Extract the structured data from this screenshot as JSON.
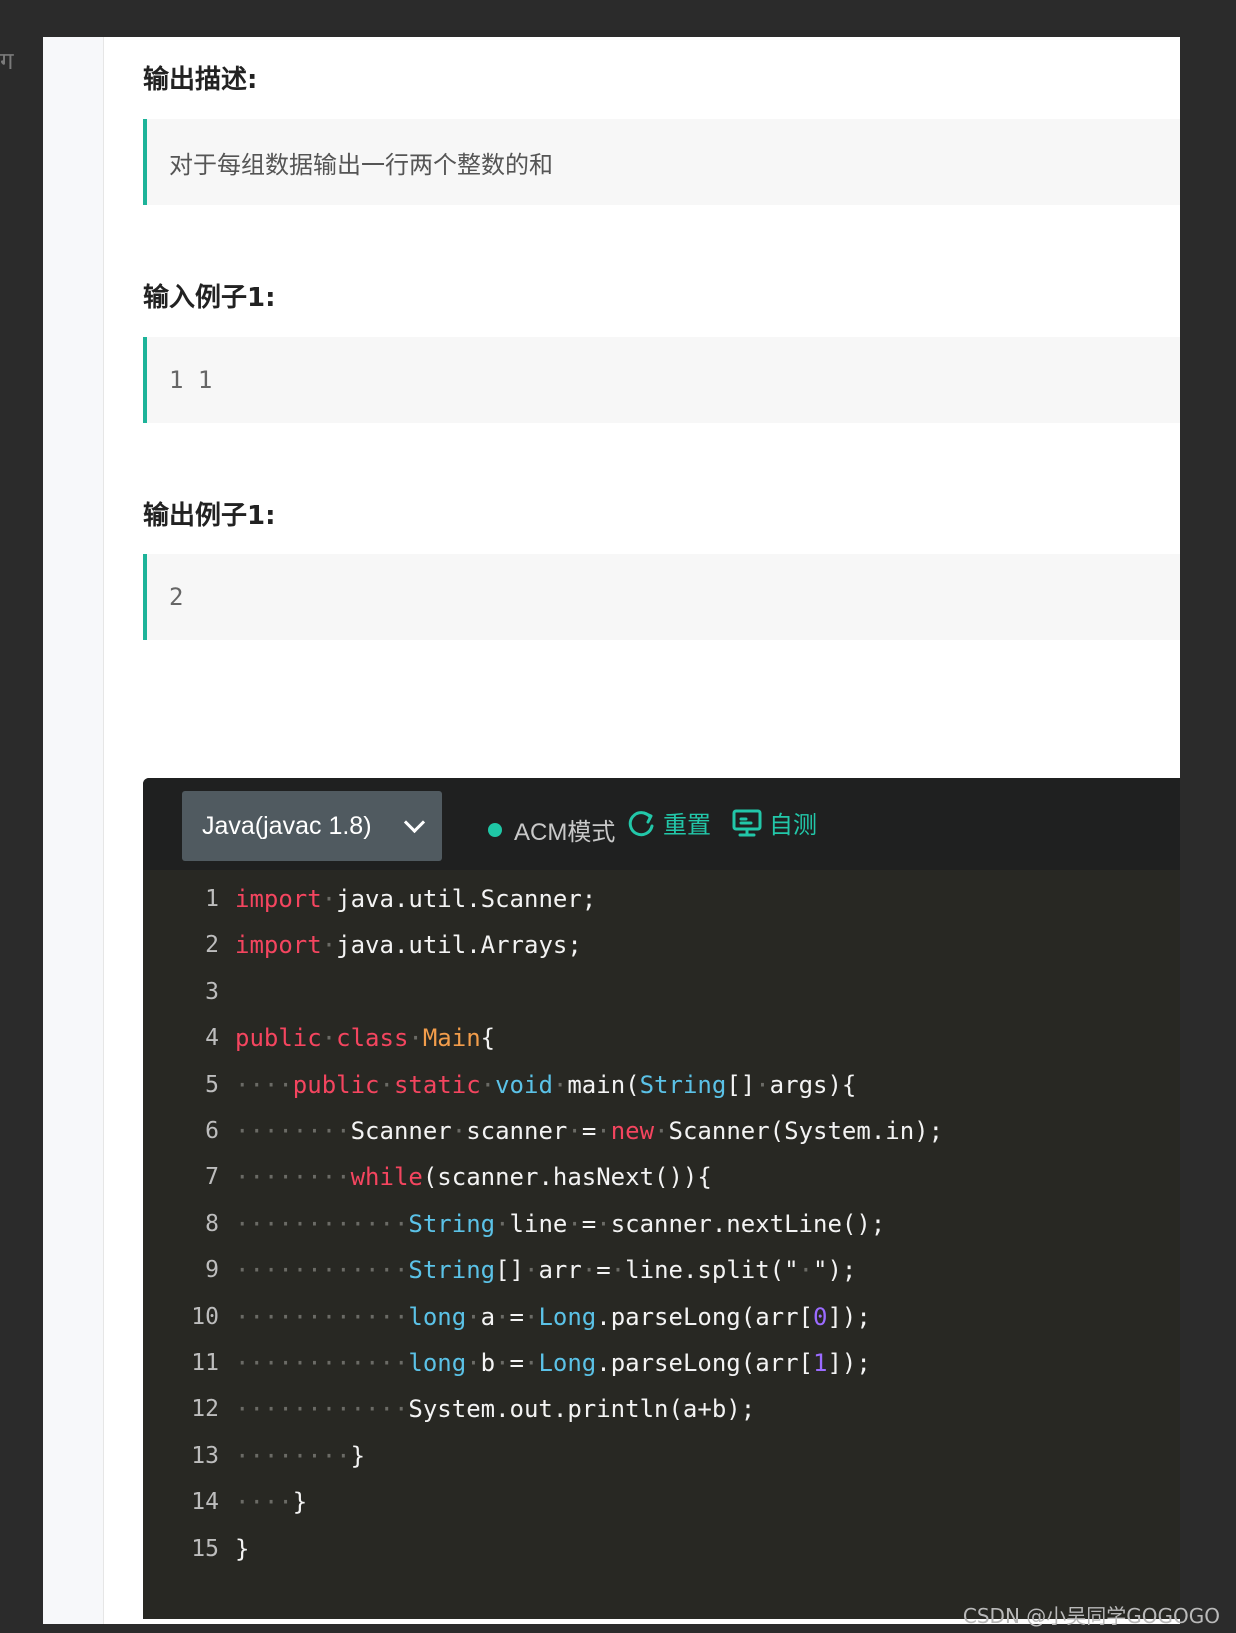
{
  "edge_glyph": "ग",
  "sections": [
    {
      "title": "输出描述:",
      "content": "对于每组数据输出一行两个整数的和"
    },
    {
      "title": "输入例子1:",
      "content": "1 1"
    },
    {
      "title": "输出例子1:",
      "content": "2"
    }
  ],
  "editor": {
    "language": "Java(javac 1.8)",
    "mode_label": "ACM模式",
    "reset_label": "重置",
    "self_test_label": "自测",
    "line_numbers": [
      "1",
      "2",
      "3",
      "4",
      "5",
      "6",
      "7",
      "8",
      "9",
      "10",
      "11",
      "12",
      "13",
      "14",
      "15"
    ],
    "lines": [
      [
        [
          "kw",
          "import"
        ],
        [
          "ws",
          "·"
        ],
        [
          "",
          "java.util.Scanner;"
        ]
      ],
      [
        [
          "kw",
          "import"
        ],
        [
          "ws",
          "·"
        ],
        [
          "",
          "java.util.Arrays;"
        ]
      ],
      [],
      [
        [
          "kw",
          "public"
        ],
        [
          "ws",
          "·"
        ],
        [
          "kw",
          "class"
        ],
        [
          "ws",
          "·"
        ],
        [
          "cls",
          "Main"
        ],
        [
          "",
          "{"
        ]
      ],
      [
        [
          "ws",
          "····"
        ],
        [
          "kw",
          "public"
        ],
        [
          "ws",
          "·"
        ],
        [
          "kw",
          "static"
        ],
        [
          "ws",
          "·"
        ],
        [
          "ty",
          "void"
        ],
        [
          "ws",
          "·"
        ],
        [
          "",
          "main("
        ],
        [
          "ty",
          "String"
        ],
        [
          "",
          "[]"
        ],
        [
          "ws",
          "·"
        ],
        [
          "",
          "args){"
        ]
      ],
      [
        [
          "ws",
          "········"
        ],
        [
          "",
          "Scanner"
        ],
        [
          "ws",
          "·"
        ],
        [
          "",
          "scanner"
        ],
        [
          "ws",
          "·"
        ],
        [
          "",
          "="
        ],
        [
          "ws",
          "·"
        ],
        [
          "kw",
          "new"
        ],
        [
          "ws",
          "·"
        ],
        [
          "",
          "Scanner(System.in);"
        ]
      ],
      [
        [
          "ws",
          "········"
        ],
        [
          "kw",
          "while"
        ],
        [
          "",
          "(scanner.hasNext()){"
        ]
      ],
      [
        [
          "ws",
          "············"
        ],
        [
          "ty",
          "String"
        ],
        [
          "ws",
          "·"
        ],
        [
          "",
          "line"
        ],
        [
          "ws",
          "·"
        ],
        [
          "",
          "="
        ],
        [
          "ws",
          "·"
        ],
        [
          "",
          "scanner.nextLine();"
        ]
      ],
      [
        [
          "ws",
          "············"
        ],
        [
          "ty",
          "String"
        ],
        [
          "",
          "[]"
        ],
        [
          "ws",
          "·"
        ],
        [
          "",
          "arr"
        ],
        [
          "ws",
          "·"
        ],
        [
          "",
          "="
        ],
        [
          "ws",
          "·"
        ],
        [
          "",
          "line.split(\""
        ],
        [
          "ws",
          "·"
        ],
        [
          "",
          "\");"
        ]
      ],
      [
        [
          "ws",
          "············"
        ],
        [
          "ty",
          "long"
        ],
        [
          "ws",
          "·"
        ],
        [
          "",
          "a"
        ],
        [
          "ws",
          "·"
        ],
        [
          "",
          "="
        ],
        [
          "ws",
          "·"
        ],
        [
          "ty",
          "Long"
        ],
        [
          "",
          ".parseLong(arr["
        ],
        [
          "num",
          "0"
        ],
        [
          "",
          "]);"
        ]
      ],
      [
        [
          "ws",
          "············"
        ],
        [
          "ty",
          "long"
        ],
        [
          "ws",
          "·"
        ],
        [
          "",
          "b"
        ],
        [
          "ws",
          "·"
        ],
        [
          "",
          "="
        ],
        [
          "ws",
          "·"
        ],
        [
          "ty",
          "Long"
        ],
        [
          "",
          ".parseLong(arr["
        ],
        [
          "num",
          "1"
        ],
        [
          "",
          "]);"
        ]
      ],
      [
        [
          "ws",
          "············"
        ],
        [
          "",
          "System.out.println(a+b);"
        ]
      ],
      [
        [
          "ws",
          "········"
        ],
        [
          "",
          "}"
        ]
      ],
      [
        [
          "ws",
          "····"
        ],
        [
          "",
          "}"
        ]
      ],
      [
        [
          "",
          "}"
        ]
      ]
    ]
  },
  "colors": {
    "accent": "#1db399",
    "keyword": "#f4455f",
    "class_name": "#f29d4b",
    "type": "#5bc2e7",
    "number": "#9b6bff"
  },
  "watermark": "CSDN @小吴同学GOGOGO"
}
